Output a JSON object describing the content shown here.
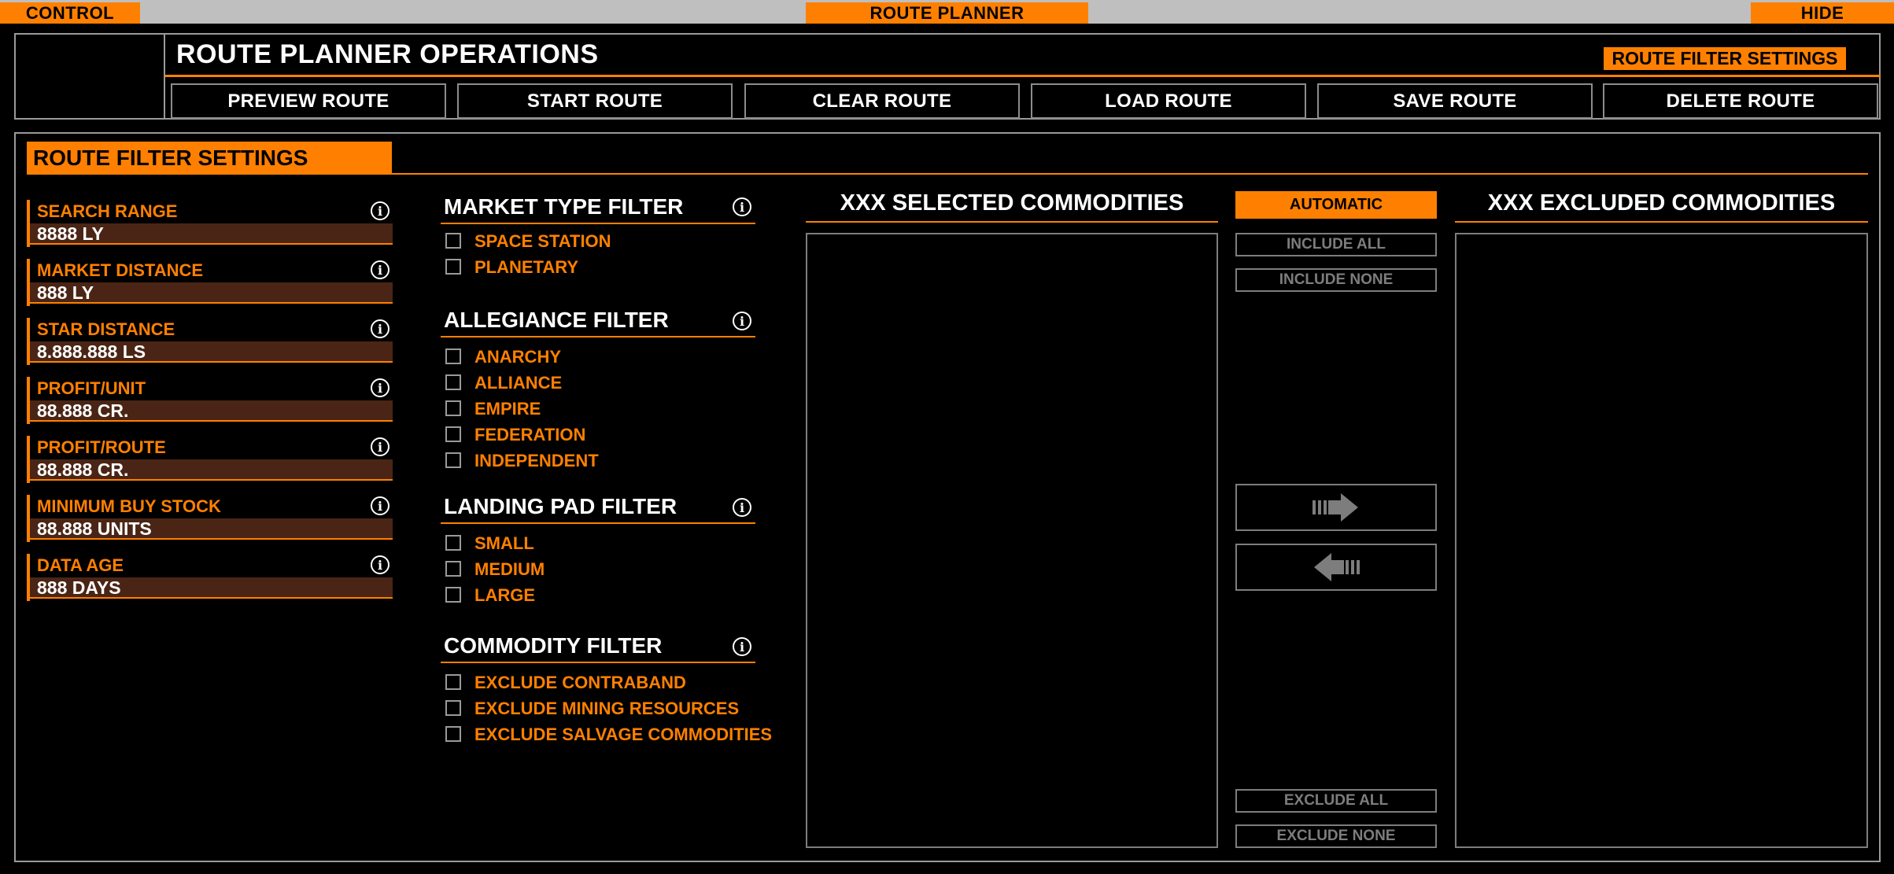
{
  "topbar": {
    "control": "CONTROL",
    "route_planner": "ROUTE PLANNER",
    "hide": "HIDE"
  },
  "header": {
    "title": "ROUTE PLANNER OPERATIONS",
    "filter_settings": "ROUTE FILTER SETTINGS",
    "buttons": [
      "PREVIEW ROUTE",
      "START ROUTE",
      "CLEAR ROUTE",
      "LOAD ROUTE",
      "SAVE ROUTE",
      "DELETE ROUTE"
    ]
  },
  "panel": {
    "title": "ROUTE FILTER SETTINGS"
  },
  "fields": [
    {
      "label": "SEARCH RANGE",
      "value": "8888 LY"
    },
    {
      "label": "MARKET DISTANCE",
      "value": "888 LY"
    },
    {
      "label": "STAR DISTANCE",
      "value": "8.888.888 LS"
    },
    {
      "label": "PROFIT/UNIT",
      "value": "88.888 CR."
    },
    {
      "label": "PROFIT/ROUTE",
      "value": "88.888 CR."
    },
    {
      "label": "MINIMUM BUY STOCK",
      "value": "88.888 UNITS"
    },
    {
      "label": "DATA AGE",
      "value": "888 DAYS"
    }
  ],
  "filters": {
    "market_type": {
      "title": "MARKET TYPE FILTER",
      "options": [
        "SPACE STATION",
        "PLANETARY"
      ]
    },
    "allegiance": {
      "title": "ALLEGIANCE FILTER",
      "options": [
        "ANARCHY",
        "ALLIANCE",
        "EMPIRE",
        "FEDERATION",
        "INDEPENDENT"
      ]
    },
    "landing_pad": {
      "title": "LANDING PAD FILTER",
      "options": [
        "SMALL",
        "MEDIUM",
        "LARGE"
      ]
    },
    "commodity": {
      "title": "COMMODITY FILTER",
      "options": [
        "EXCLUDE CONTRABAND",
        "EXCLUDE MINING RESOURCES",
        "EXCLUDE SALVAGE COMMODITIES"
      ]
    }
  },
  "commodities": {
    "selected_title": "XXX SELECTED COMMODITIES",
    "excluded_title": "XXX EXCLUDED COMMODITIES",
    "automatic": "AUTOMATIC",
    "include_all": "INCLUDE ALL",
    "include_none": "INCLUDE NONE",
    "exclude_all": "EXCLUDE ALL",
    "exclude_none": "EXCLUDE NONE"
  },
  "info_symbol": "i",
  "colors": {
    "accent": "#ff8000",
    "field_bg": "#4a2515",
    "border": "#9a9a9a",
    "disabled": "#7d7d7d"
  },
  "icons": [
    "info-icon",
    "arrow-right-icon",
    "arrow-left-icon"
  ]
}
